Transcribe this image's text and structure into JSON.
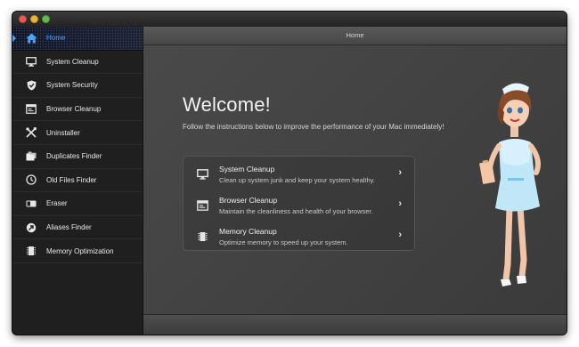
{
  "window": {
    "traffic_lights": [
      "close",
      "minimize",
      "zoom"
    ]
  },
  "sidebar": {
    "items": [
      {
        "label": "Home",
        "icon": "home-icon",
        "active": true
      },
      {
        "label": "System Cleanup",
        "icon": "monitor-icon",
        "active": false
      },
      {
        "label": "System Security",
        "icon": "shield-icon",
        "active": false
      },
      {
        "label": "Browser Cleanup",
        "icon": "browser-icon",
        "active": false
      },
      {
        "label": "Uninstaller",
        "icon": "tools-icon",
        "active": false
      },
      {
        "label": "Duplicates Finder",
        "icon": "folders-icon",
        "active": false
      },
      {
        "label": "Old Files Finder",
        "icon": "clock-icon",
        "active": false
      },
      {
        "label": "Eraser",
        "icon": "eraser-icon",
        "active": false
      },
      {
        "label": "Aliases Finder",
        "icon": "alias-arrow-icon",
        "active": false
      },
      {
        "label": "Memory Optimization",
        "icon": "memory-chip-icon",
        "active": false
      }
    ],
    "accent_color": "#4aa3ff"
  },
  "main": {
    "header_title": "Home",
    "welcome_title": "Welcome!",
    "welcome_subtitle": "Follow the instructions below to improve the performance of your Mac immediately!",
    "cards": [
      {
        "title": "System Cleanup",
        "description": "Clean up system junk and keep your system healthy.",
        "icon": "monitor-icon"
      },
      {
        "title": "Browser Cleanup",
        "description": "Maintain the cleanliness and health of your browser.",
        "icon": "browser-icon"
      },
      {
        "title": "Memory Cleanup",
        "description": "Optimize memory to speed up your system.",
        "icon": "memory-chip-icon"
      }
    ],
    "mascot": "nurse-illustration"
  }
}
